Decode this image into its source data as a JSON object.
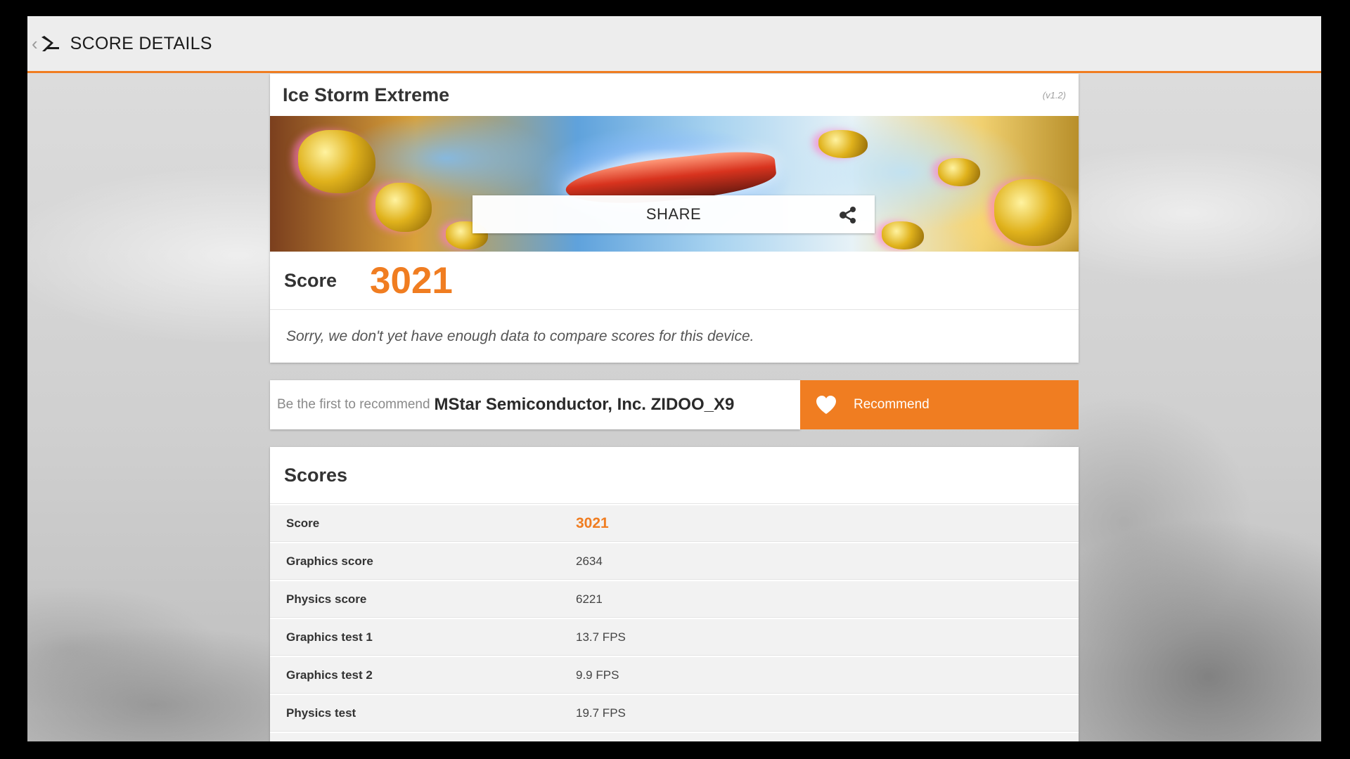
{
  "header": {
    "back_chevron": "‹",
    "title": "SCORE DETAILS",
    "logo_icon": "3dmark-logo-icon"
  },
  "test": {
    "name": "Ice Storm Extreme",
    "version": "(v1.2)",
    "share_label": "SHARE",
    "share_icon": "share-icon",
    "score_label": "Score",
    "score_value": "3021",
    "compare_note": "Sorry, we don't yet have enough data to compare scores for this device."
  },
  "recommend": {
    "prompt": "Be the first to recommend",
    "device": "MStar Semiconductor, Inc. ZIDOO_X9",
    "button_label": "Recommend",
    "button_icon": "heart-icon"
  },
  "scores": {
    "title": "Scores",
    "rows": [
      {
        "name": "Score",
        "value": "3021"
      },
      {
        "name": "Graphics score",
        "value": "2634"
      },
      {
        "name": "Physics score",
        "value": "6221"
      },
      {
        "name": "Graphics test 1",
        "value": "13.7 FPS"
      },
      {
        "name": "Graphics test 2",
        "value": "9.9 FPS"
      },
      {
        "name": "Physics test",
        "value": "19.7 FPS"
      }
    ]
  },
  "colors": {
    "accent": "#f07d21",
    "header_bg": "#ededed",
    "text_dark": "#333333"
  }
}
